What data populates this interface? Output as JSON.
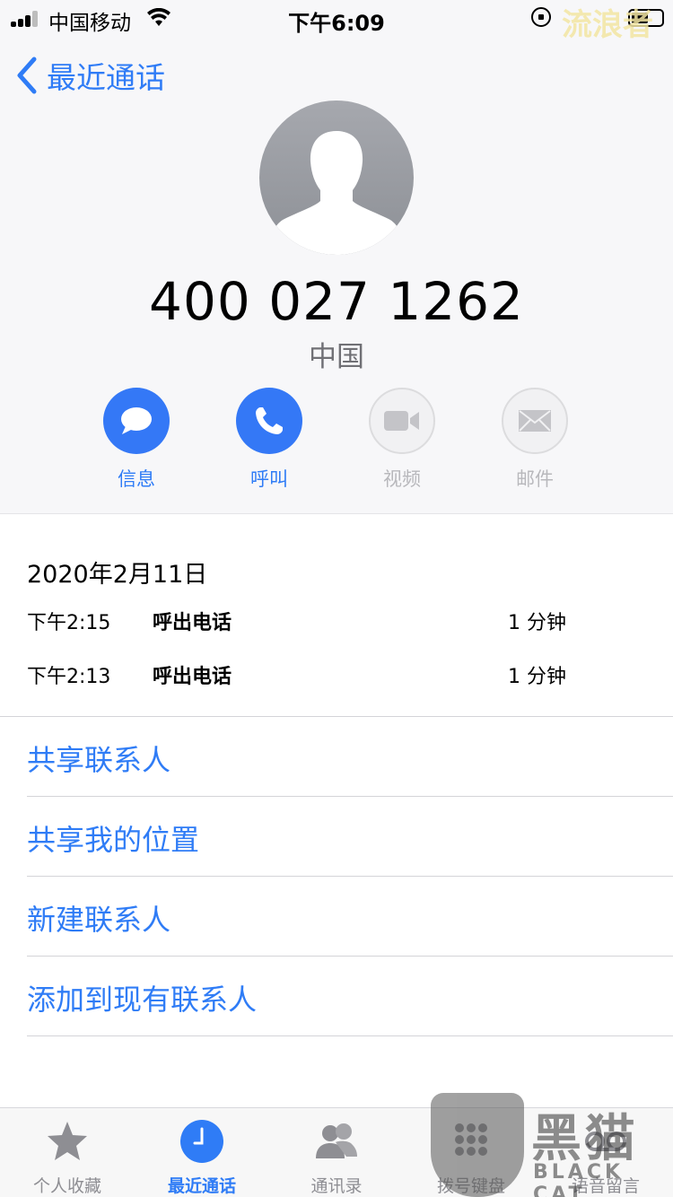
{
  "status_bar": {
    "carrier": "中国移动",
    "time": "下午6:09",
    "watermark": "流浪者"
  },
  "nav": {
    "back_label": "最近通话"
  },
  "contact": {
    "number": "400 027 1262",
    "region": "中国"
  },
  "actions": [
    {
      "label": "信息",
      "icon": "message-bubble-icon",
      "enabled": true
    },
    {
      "label": "呼叫",
      "icon": "phone-icon",
      "enabled": true
    },
    {
      "label": "视频",
      "icon": "video-camera-icon",
      "enabled": false
    },
    {
      "label": "邮件",
      "icon": "envelope-icon",
      "enabled": false
    }
  ],
  "history": {
    "date": "2020年2月11日",
    "calls": [
      {
        "time": "下午2:15",
        "type": "呼出电话",
        "duration": "1 分钟"
      },
      {
        "time": "下午2:13",
        "type": "呼出电话",
        "duration": "1 分钟"
      }
    ]
  },
  "links": [
    "共享联系人",
    "共享我的位置",
    "新建联系人",
    "添加到现有联系人"
  ],
  "tabs": [
    {
      "label": "个人收藏",
      "icon": "star-icon",
      "active": false
    },
    {
      "label": "最近通话",
      "icon": "clock-icon",
      "active": true
    },
    {
      "label": "通讯录",
      "icon": "contacts-icon",
      "active": false
    },
    {
      "label": "拨号键盘",
      "icon": "keypad-icon",
      "active": false
    },
    {
      "label": "语音留言",
      "icon": "voicemail-icon",
      "active": false
    }
  ],
  "watermark_logo": {
    "text_cn": "黑猫",
    "text_en": "BLACK CAT"
  },
  "colors": {
    "accent": "#2f7cf6",
    "disabled": "#b8b8bc",
    "background": "#f7f7f9"
  }
}
